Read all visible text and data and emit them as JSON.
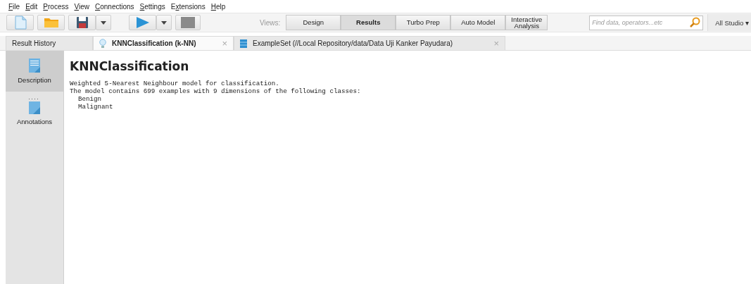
{
  "menu": [
    {
      "label": "File",
      "kind": "first"
    },
    {
      "label": "Edit",
      "kind": "first"
    },
    {
      "label": "Process",
      "kind": "first"
    },
    {
      "label": "View",
      "kind": "first"
    },
    {
      "label": "Connections",
      "kind": "first"
    },
    {
      "label": "Settings",
      "kind": "first"
    },
    {
      "label": "Extensions",
      "kind": "second"
    },
    {
      "label": "Help",
      "kind": "first"
    }
  ],
  "toolbar": [
    {
      "kind": "new"
    },
    {
      "kind": "open"
    },
    {
      "kind": "save"
    },
    {
      "kind": "dropdown"
    },
    {
      "kind": "run"
    },
    {
      "kind": "dropdown"
    },
    {
      "kind": "stop"
    }
  ],
  "views": {
    "label": "Views:",
    "items": [
      {
        "label": "Design",
        "selected": false
      },
      {
        "label": "Results",
        "selected": true
      },
      {
        "label": "Turbo Prep",
        "selected": false
      },
      {
        "label": "Auto Model",
        "selected": false
      },
      {
        "label": "Interactive Analysis",
        "selected": false
      }
    ]
  },
  "search": {
    "placeholder": "Find data, operators...etc"
  },
  "scope": {
    "label": "All Studio ▾"
  },
  "tabs": [
    {
      "label": "Result History",
      "kind": "plain",
      "selected": false
    },
    {
      "label": "KNNClassification (k-NN)",
      "kind": "model",
      "selected": true,
      "close": "×"
    },
    {
      "label": "ExampleSet (//Local Repository/data/Data Uji Kanker Payudara)",
      "kind": "data",
      "selected": false,
      "close": "×"
    }
  ],
  "side_panel": [
    {
      "label": "Description",
      "kind": "description",
      "selected": true
    },
    {
      "label": "Annotations",
      "kind": "annotations",
      "selected": false
    }
  ],
  "content": {
    "title": "KNNClassification",
    "lines": [
      "Weighted 5-Nearest Neighbour model for classification.",
      "The model contains 699 examples with 9 dimensions of the following classes:"
    ],
    "classes": [
      "Benign",
      "Malignant"
    ]
  }
}
